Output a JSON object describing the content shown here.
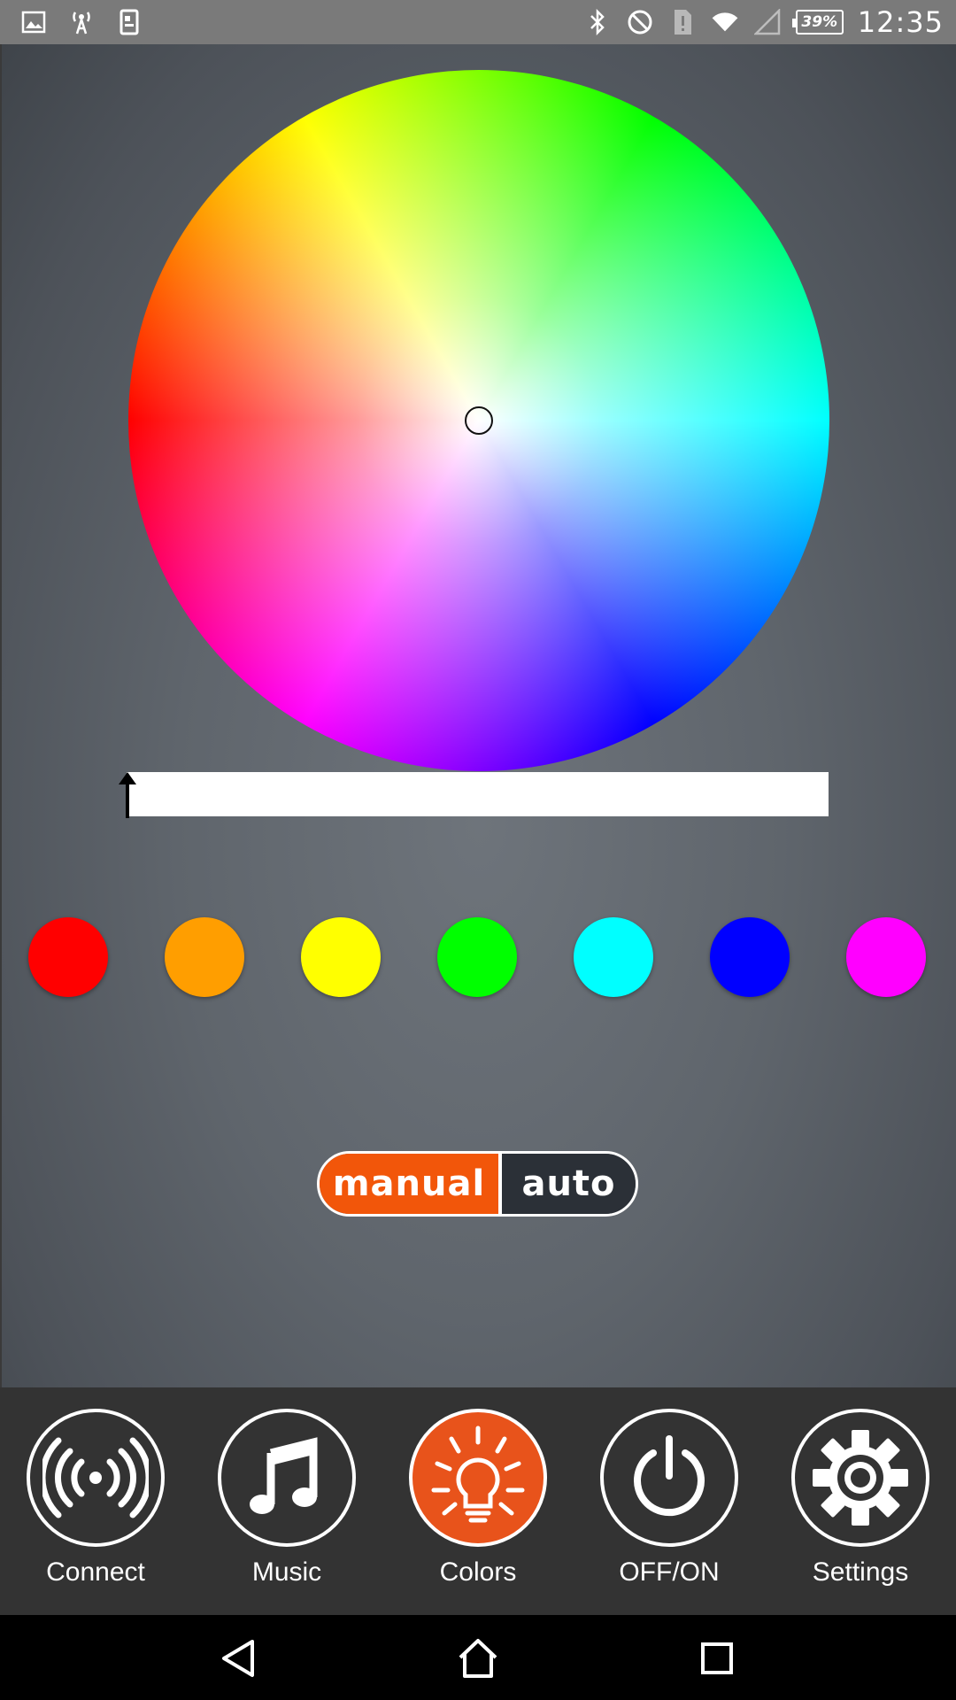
{
  "status_bar": {
    "left_icons": [
      "gallery-icon",
      "wireless-tower-icon",
      "phone-card-icon"
    ],
    "right_icons": [
      "bluetooth-icon",
      "do-not-disturb-icon",
      "sim-alert-icon",
      "wifi-icon",
      "signal-icon"
    ],
    "battery": "39%",
    "time": "12:35"
  },
  "color_picker": {
    "selected_color": "#ffffff",
    "brightness_fraction": 0.0
  },
  "swatches": [
    {
      "name": "red",
      "color": "#ff0000"
    },
    {
      "name": "orange",
      "color": "#ff9e00"
    },
    {
      "name": "yellow",
      "color": "#ffff00"
    },
    {
      "name": "green",
      "color": "#00ff00"
    },
    {
      "name": "cyan",
      "color": "#00ffff"
    },
    {
      "name": "blue",
      "color": "#0000ff"
    },
    {
      "name": "magenta",
      "color": "#ff00ff"
    }
  ],
  "mode": {
    "manual_label": "manual",
    "auto_label": "auto",
    "selected": "manual",
    "active_color": "#f2560a"
  },
  "nav": {
    "items": [
      {
        "label": "Connect",
        "icon": "wireless-signal-icon",
        "active": false
      },
      {
        "label": "Music",
        "icon": "music-note-icon",
        "active": false
      },
      {
        "label": "Colors",
        "icon": "light-bulb-icon",
        "active": true
      },
      {
        "label": "OFF/ON",
        "icon": "power-icon",
        "active": false
      },
      {
        "label": "Settings",
        "icon": "gear-icon",
        "active": false
      }
    ],
    "active_color": "#e8531b"
  },
  "system_nav": [
    "back-icon",
    "home-icon",
    "recents-icon"
  ]
}
